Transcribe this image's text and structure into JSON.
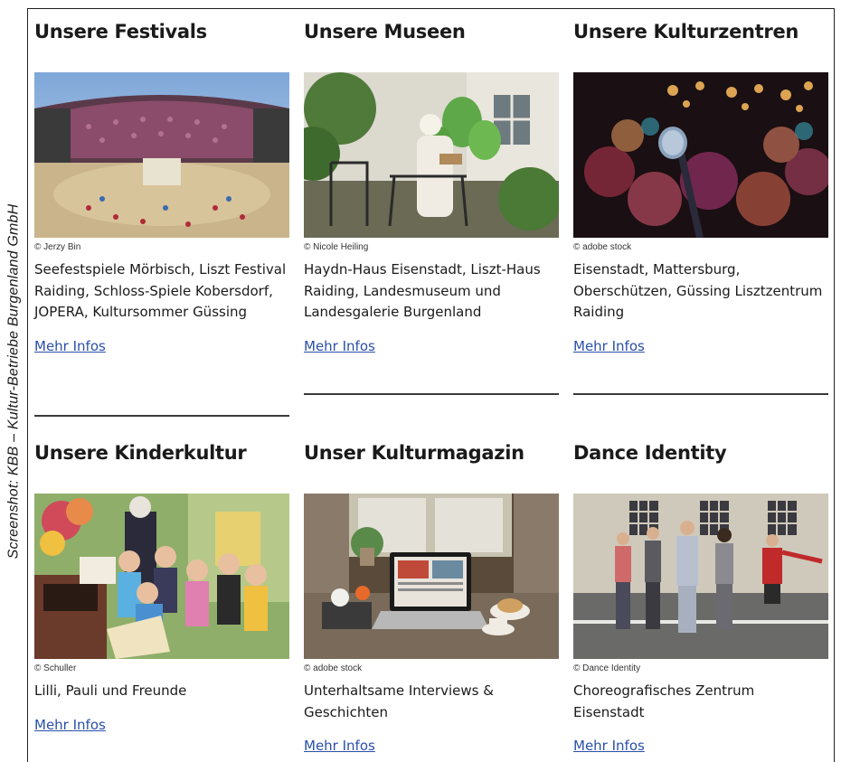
{
  "side_credit": "Screenshot: KBB – Kultur-Betriebe Burgenland GmbH",
  "cards": [
    {
      "title": "Unsere Festivals",
      "image_icon": "festival-stage-image",
      "credit": "© Jerzy Bin",
      "description": "Seefestspiele Mörbisch, Liszt Festival Raiding, Schloss-Spiele Kobersdorf, JOPERA, Kultursommer Güssing",
      "link": "Mehr Infos"
    },
    {
      "title": "Unsere Museen",
      "image_icon": "museum-garden-image",
      "credit": "© Nicole Heiling",
      "description": "Haydn-Haus Eisenstadt, Liszt-Haus Raiding, Landesmuseum und Landesgalerie Burgenland",
      "link": "Mehr Infos"
    },
    {
      "title": "Unsere Kulturzentren",
      "image_icon": "microphone-stage-image",
      "credit": "© adobe stock",
      "description": "Eisenstadt, Mattersburg, Oberschützen, Güssing Lisztzentrum Raiding",
      "link": "Mehr Infos"
    },
    {
      "title": "Unsere Kinderkultur",
      "image_icon": "children-group-image",
      "credit": "© Schuller",
      "description": "Lilli, Pauli und Freunde",
      "link": "Mehr Infos"
    },
    {
      "title": "Unser Kulturmagazin",
      "image_icon": "laptop-breakfast-image",
      "credit": "© adobe stock",
      "description": "Unterhaltsame Interviews & Geschichten",
      "link": "Mehr Infos"
    },
    {
      "title": "Dance Identity",
      "image_icon": "dancers-street-image",
      "credit": "© Dance Identity",
      "description": "Choreografisches Zentrum Eisenstadt",
      "link": "Mehr Infos"
    }
  ]
}
